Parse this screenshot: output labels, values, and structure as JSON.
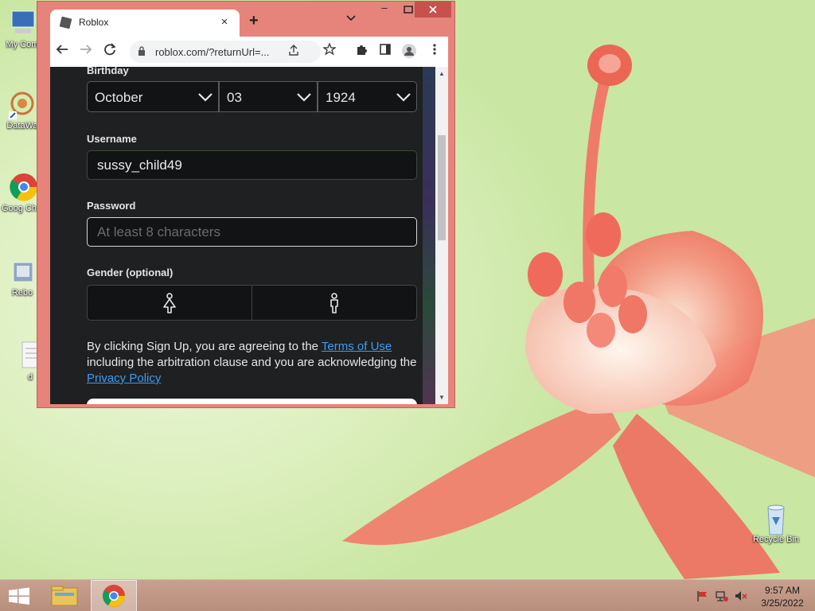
{
  "desktop": {
    "icons": [
      {
        "label": "My Com"
      },
      {
        "label": "DataWa"
      },
      {
        "label": "Goog Chron"
      },
      {
        "label": "Rebo"
      },
      {
        "label": "d"
      },
      {
        "label": "Recycle Bin"
      }
    ]
  },
  "browser": {
    "tab_title": "Roblox",
    "url": "roblox.com/?returnUrl=...",
    "new_tab": "+",
    "close_tab": "×"
  },
  "form": {
    "birthday_label": "Birthday",
    "month": "October",
    "day": "03",
    "year": "1924",
    "username_label": "Username",
    "username_value": "sussy_child49",
    "password_label": "Password",
    "password_placeholder": "At least 8 characters",
    "gender_label": "Gender (optional)",
    "terms_prefix": "By clicking Sign Up, you are agreeing to the ",
    "terms_link": "Terms of Use",
    "terms_middle": " including the arbitration clause and you are acknowledging the ",
    "privacy_link": "Privacy Policy"
  },
  "taskbar": {
    "time": "9:57 AM",
    "date": "3/25/2022"
  },
  "colors": {
    "window_frame": "#e6847c",
    "page_bg": "#1f2022",
    "link": "#3b9cf2"
  }
}
